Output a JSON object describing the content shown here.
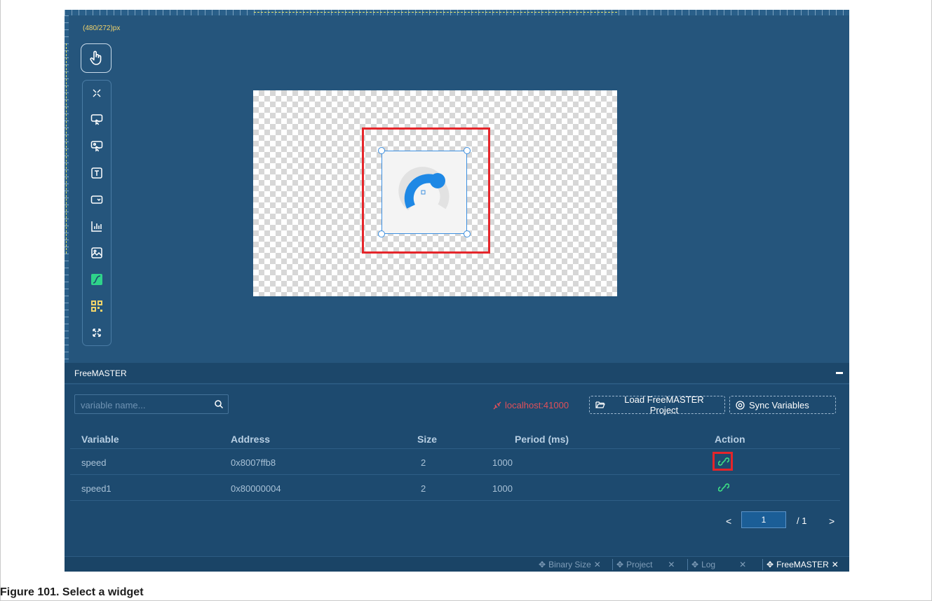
{
  "canvas": {
    "size_label": "(480/272)px"
  },
  "toolbar": {
    "tools": [
      "pointer",
      "collapse",
      "button",
      "image-button",
      "label",
      "dropdown",
      "bar-chart",
      "image",
      "slider",
      "qr-code",
      "expand"
    ]
  },
  "freemaster": {
    "title": "FreeMASTER",
    "search_placeholder": "variable name...",
    "connection": "localhost:41000",
    "load_project_label": "Load FreeMASTER Project",
    "sync_label": "Sync Variables",
    "columns": [
      "Variable",
      "Address",
      "Size",
      "Period (ms)",
      "Action"
    ],
    "rows": [
      {
        "variable": "speed",
        "address": "0x8007ffb8",
        "size": "2",
        "period": "1000"
      },
      {
        "variable": "speed1",
        "address": "0x80000004",
        "size": "2",
        "period": "1000"
      }
    ],
    "pager": {
      "current": "1",
      "total": "/ 1"
    }
  },
  "tabs": [
    {
      "label": "Binary Size",
      "active": false
    },
    {
      "label": "Project",
      "active": false
    },
    {
      "label": "Log",
      "active": false
    },
    {
      "label": "FreeMASTER",
      "active": true
    }
  ],
  "caption": "Figure 101.  Select a widget",
  "colors": {
    "accent": "#1e88e5",
    "highlight": "#e5252a",
    "link": "#3ddc84",
    "error": "#e0505a"
  }
}
